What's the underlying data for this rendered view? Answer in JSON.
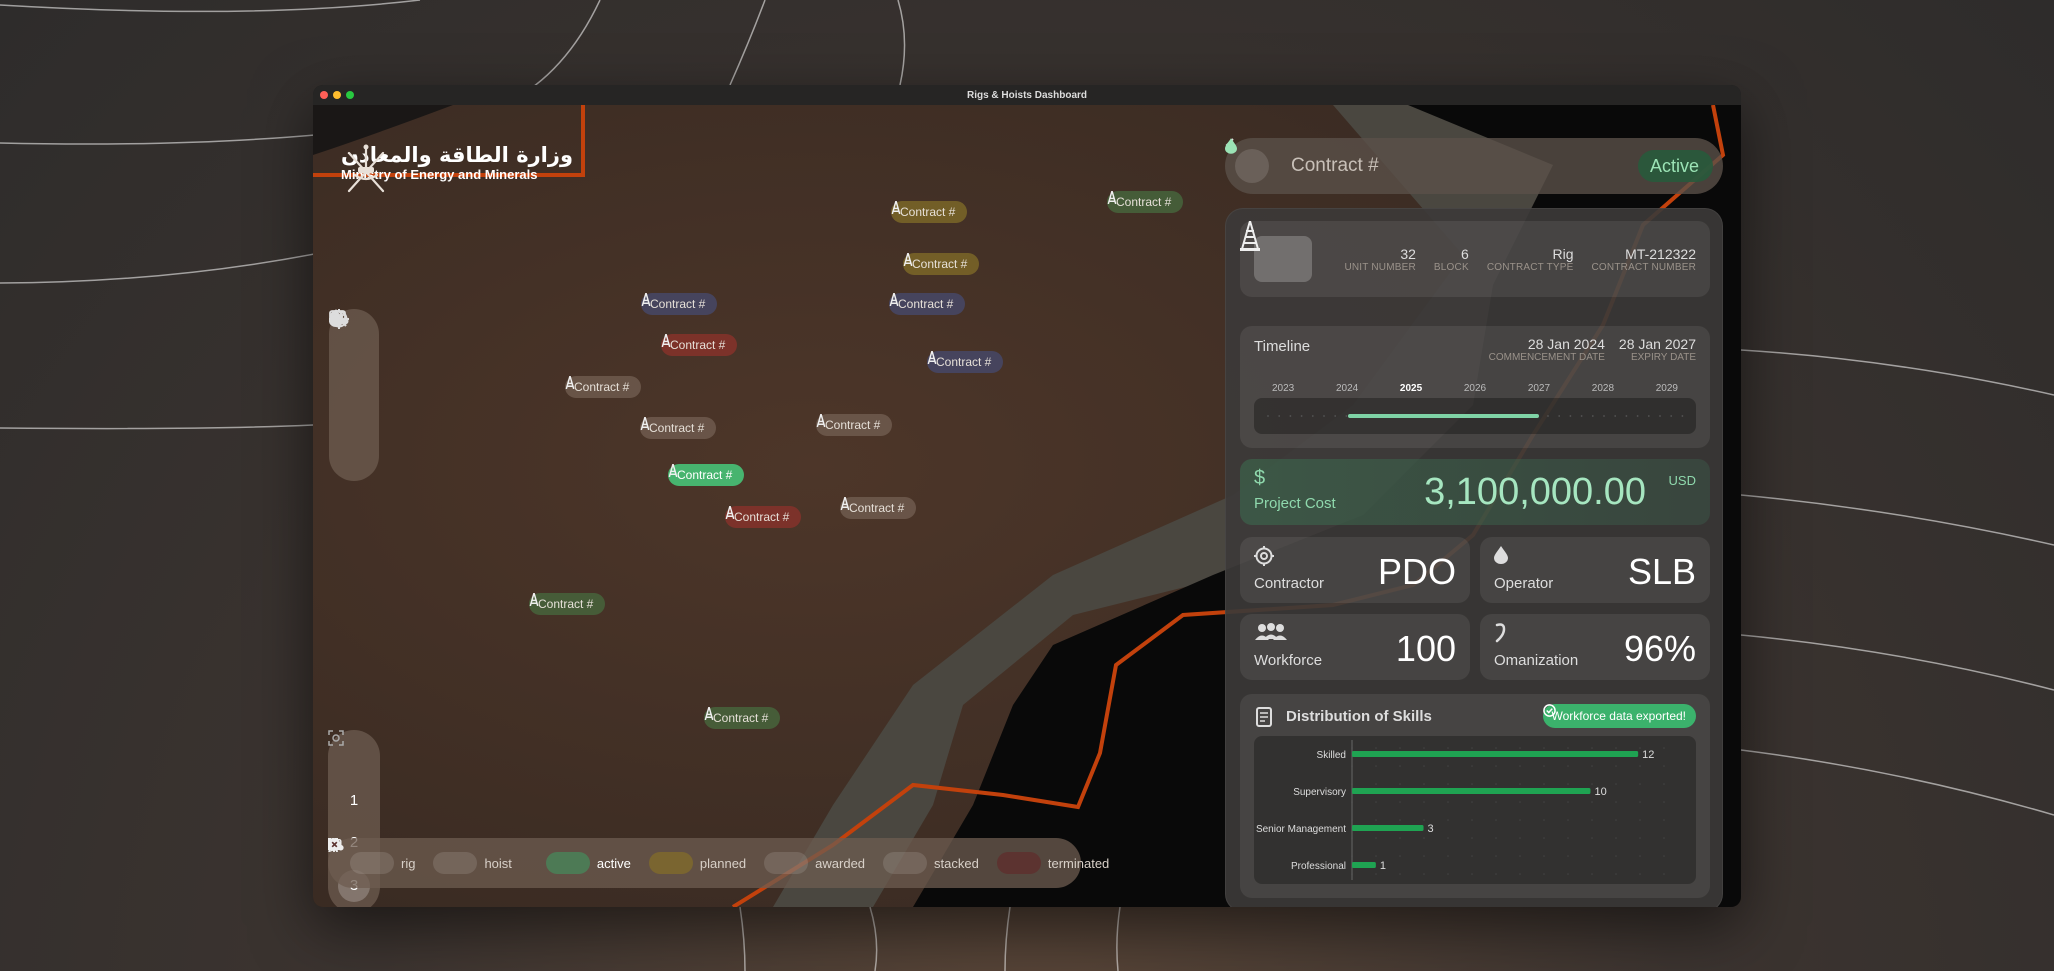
{
  "window": {
    "title": "Rigs & Hoists Dashboard"
  },
  "logo": {
    "arabic": "وزارة الطاقة والمعادن",
    "english": "Ministry of Energy and Minerals"
  },
  "toolbar": {
    "icons": [
      "drop-icon",
      "gear-icon",
      "calendar-icon",
      "zoom-icon"
    ]
  },
  "levels": {
    "items": [
      "1",
      "2",
      "3"
    ],
    "selected": "3"
  },
  "legend": {
    "rig": "rig",
    "hoist": "hoist",
    "active": "active",
    "planned": "planned",
    "awarded": "awarded",
    "stacked": "stacked",
    "terminated": "terminated"
  },
  "colors": {
    "active": "#4caf73",
    "planned": "#8b7a2e",
    "awarded": "#4a4a66",
    "stacked": "#6a5a50",
    "terminated": "#7a3a32",
    "border_line": "#c2410c"
  },
  "pins": [
    {
      "label": "Contract #",
      "status": "active-dim"
    },
    {
      "label": "Contract #",
      "status": "planned"
    },
    {
      "label": "Contract #",
      "status": "planned"
    },
    {
      "label": "Contract #",
      "status": "awarded"
    },
    {
      "label": "Contract #",
      "status": "awarded"
    },
    {
      "label": "Contract #",
      "status": "terminated"
    },
    {
      "label": "Contract #",
      "status": "awarded"
    },
    {
      "label": "Contract #",
      "status": "stacked"
    },
    {
      "label": "Contract #",
      "status": "stacked"
    },
    {
      "label": "Contract #",
      "status": "stacked"
    },
    {
      "label": "Contract #",
      "status": "active-selected"
    },
    {
      "label": "Contract #",
      "status": "terminated"
    },
    {
      "label": "Contract #",
      "status": "stacked"
    },
    {
      "label": "Contract #",
      "status": "active-dim"
    },
    {
      "label": "Contract #",
      "status": "active-dim"
    }
  ],
  "panel": {
    "title": "Contract #",
    "status": "Active",
    "info": {
      "unit_number": {
        "value": "32",
        "label": "UNIT NUMBER"
      },
      "block": {
        "value": "6",
        "label": "BLOCK"
      },
      "contract_type": {
        "value": "Rig",
        "label": "CONTRACT TYPE"
      },
      "contract_number": {
        "value": "MT-212322",
        "label": "CONTRACT NUMBER"
      }
    },
    "timeline": {
      "title": "Timeline",
      "commencement": {
        "value": "28 Jan 2024",
        "label": "COMMENCEMENT DATE"
      },
      "expiry": {
        "value": "28 Jan 2027",
        "label": "EXPIRY DATE"
      },
      "years": [
        "2023",
        "2024",
        "2025",
        "2026",
        "2027",
        "2028",
        "2029"
      ],
      "current_year": "2025",
      "start_fraction": 0.1667,
      "end_fraction": 0.6667
    },
    "cost": {
      "symbol": "$",
      "label": "Project Cost",
      "amount": "3,100,000.00",
      "currency": "USD"
    },
    "contractor": {
      "label": "Contractor",
      "value": "PDO"
    },
    "operator": {
      "label": "Operator",
      "value": "SLB"
    },
    "workforce": {
      "label": "Workforce",
      "value": "100"
    },
    "omanization": {
      "label": "Omanization",
      "value": "96%"
    },
    "skills": {
      "title": "Distribution of Skills",
      "badge": "Workforce data exported!"
    }
  },
  "chart_data": {
    "type": "bar",
    "orientation": "horizontal",
    "categories": [
      "Skilled",
      "Supervisory",
      "Senior Management",
      "Professional"
    ],
    "values": [
      12,
      10,
      3,
      1
    ],
    "xlim": [
      0,
      13
    ],
    "grid": true,
    "color": "#1fa352"
  }
}
